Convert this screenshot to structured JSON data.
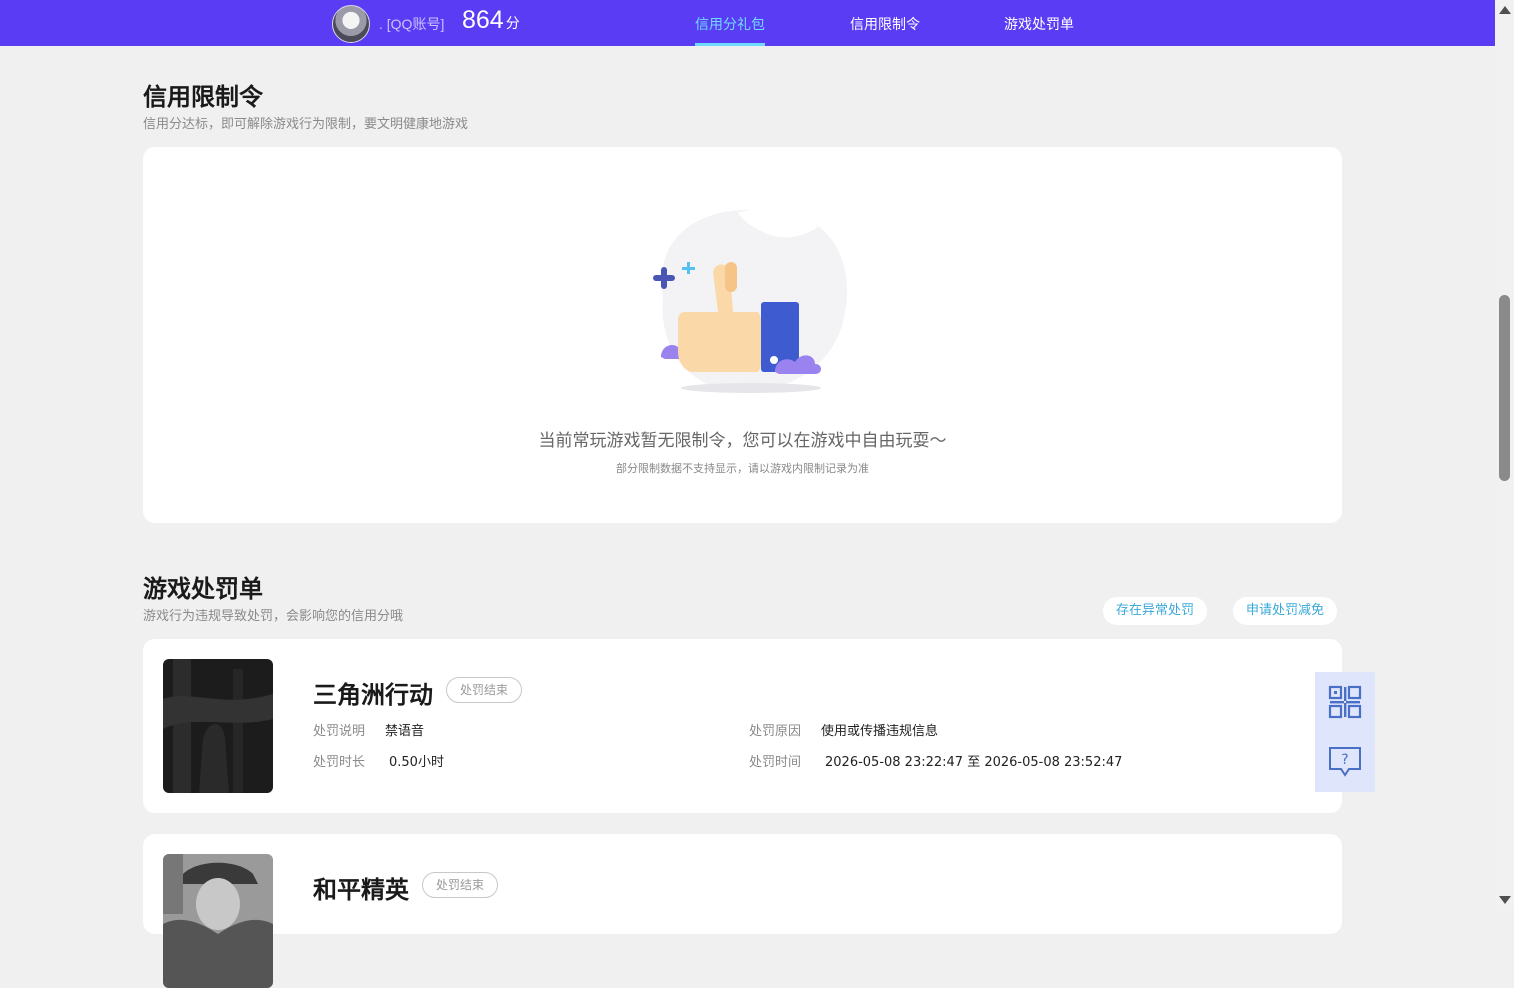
{
  "header": {
    "account": ". [QQ账号]",
    "score": "864",
    "score_unit": "分",
    "nav": [
      {
        "label": "信用分礼包",
        "active": true
      },
      {
        "label": "信用限制令",
        "active": false
      },
      {
        "label": "游戏处罚单",
        "active": false
      }
    ]
  },
  "restriction": {
    "title": "信用限制令",
    "subtitle": "信用分达标，即可解除游戏行为限制，要文明健康地游戏",
    "empty_message": "当前常玩游戏暂无限制令，您可以在游戏中自由玩耍～",
    "empty_note": "部分限制数据不支持显示，请以游戏内限制记录为准"
  },
  "penalty": {
    "title": "游戏处罚单",
    "subtitle": "游戏行为违规导致处罚，会影响您的信用分哦",
    "buttons": [
      "存在异常处罚",
      "申请处罚减免"
    ],
    "records": [
      {
        "game": "三角洲行动",
        "status": "处罚结束",
        "desc_label": "处罚说明",
        "desc": "禁语音",
        "reason_label": "处罚原因",
        "reason": "使用或传播违规信息",
        "duration_label": "处罚时长",
        "duration": "0.50小时",
        "time_label": "处罚时间",
        "time": "2026-05-08 23:22:47 至 2026-05-08 23:52:47"
      },
      {
        "game": "和平精英",
        "status": "处罚结束"
      }
    ]
  },
  "tools": {
    "qr_icon": "qr-code-icon",
    "help_icon": "help-chat-icon"
  },
  "colors": {
    "header_bg": "#5a3cf5",
    "nav_active": "#6fdcff",
    "link": "#3aa9d8",
    "page_bg": "#f0f0f0"
  }
}
